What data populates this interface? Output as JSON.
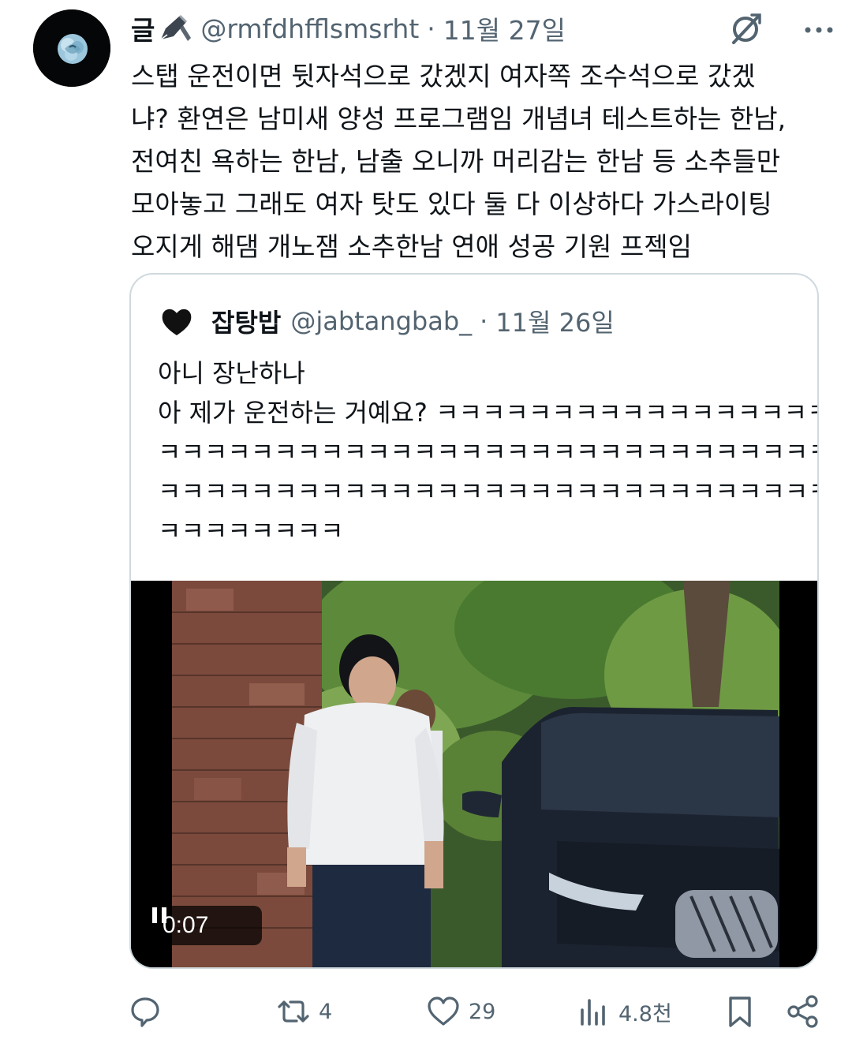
{
  "tweet": {
    "author_name": "글",
    "handle": "@rmfdhfflsmsrht",
    "separator": "·",
    "date": "11월 27일",
    "text_lines": [
      "스탭 운전이면 뒷자석으로 갔겠지 여자쪽 조수석으로 갔겠",
      "냐? 환연은 남미새 양성 프로그램임 개념녀 테스트하는 한남,",
      "전여친 욕하는 한남, 남출 오니까 머리감는 한남 등 소추들만",
      "모아놓고 그래도 여자 탓도 있다 둘 다 이상하다 가스라이팅",
      "오지게 해댐 개노잼 소추한남 연애 성공 기원 프젝임"
    ]
  },
  "quoted": {
    "author_name": "잡탕밥",
    "handle": "@jabtangbab_",
    "separator": "·",
    "date": "11월 26일",
    "text_lines": [
      "아니 장난하나",
      "아 제가 운전하는 거예요? ㅋㅋㅋㅋㅋㅋㅋㅋㅋㅋㅋㅋㅋㅋㅋㅋㅋ",
      "ㅋㅋㅋㅋㅋㅋㅋㅋㅋㅋㅋㅋㅋㅋㅋㅋㅋㅋㅋㅋㅋㅋㅋㅋㅋㅋㅋㅋㅋㅋㅋㅋㅋ",
      "ㅋㅋㅋㅋㅋㅋㅋㅋㅋㅋㅋㅋㅋㅋㅋㅋㅋㅋㅋㅋㅋㅋㅋㅋㅋㅋㅋㅋㅋㅋㅋㅋㅋ",
      "ㅋㅋㅋㅋㅋㅋㅋㅋ"
    ],
    "video": {
      "timecode": "0:07",
      "state_icon": "pause-icon"
    }
  },
  "actions": {
    "reply_count": "",
    "retweet_count": "4",
    "like_count": "29",
    "views_count": "4.8천"
  },
  "colors": {
    "text_primary": "#0f1419",
    "text_secondary": "#536471",
    "border": "#cfd9de"
  }
}
